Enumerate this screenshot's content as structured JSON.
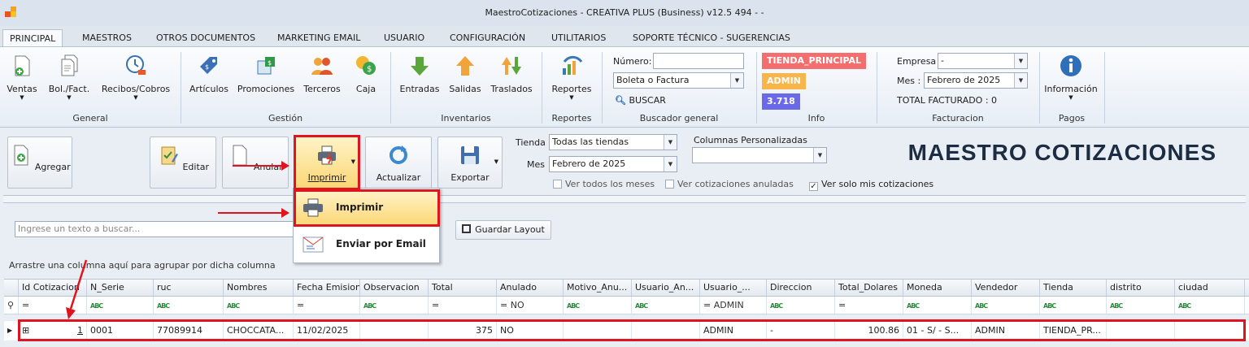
{
  "window": {
    "title": "MaestroCotizaciones - CREATIVA PLUS (Business) v12.5 494 - -"
  },
  "menu_tabs": [
    "PRINCIPAL",
    "MAESTROS",
    "OTROS DOCUMENTOS",
    "MARKETING EMAIL",
    "USUARIO",
    "CONFIGURACIÓN",
    "UTILITARIOS",
    "SOPORTE TÉCNICO - SUGERENCIAS"
  ],
  "ribbon": {
    "general": {
      "label": "General",
      "ventas": "Ventas",
      "bol_fact": "Bol./Fact.",
      "recibos": "Recibos/Cobros"
    },
    "gestion": {
      "label": "Gestión",
      "articulos": "Artículos",
      "promociones": "Promociones",
      "terceros": "Terceros",
      "caja": "Caja"
    },
    "inventarios": {
      "label": "Inventarios",
      "entradas": "Entradas",
      "salidas": "Salidas",
      "traslados": "Traslados"
    },
    "reportes": {
      "label": "Reportes",
      "reportes_btn": "Reportes"
    },
    "buscador": {
      "label": "Buscador general",
      "numero_label": "Número:",
      "numero_value": "",
      "doc_type": "Boleta o Factura",
      "buscar": "BUSCAR"
    },
    "info": {
      "label": "Info",
      "tienda": "TIENDA_PRINCIPAL",
      "usuario": "ADMIN",
      "version": "3.718"
    },
    "facturacion": {
      "label": "Facturacion",
      "empresa_label": "Empresa",
      "empresa_value": "-",
      "mes_label": "Mes :",
      "mes_value": "Febrero de 2025",
      "total": "TOTAL FACTURADO : 0"
    },
    "pagos": {
      "label": "Pagos",
      "informacion": "Información"
    }
  },
  "toolbar": {
    "agregar": "Agregar",
    "editar": "Editar",
    "anular": "Anular",
    "imprimir": "Imprimir",
    "actualizar": "Actualizar",
    "exportar": "Exportar",
    "tienda_label": "Tienda",
    "tienda_value": "Todas las tiendas",
    "mes_label": "Mes",
    "mes_value": "Febrero de 2025",
    "columnas_label": "Columnas Personalizadas",
    "columnas_value": "",
    "ver_todos": "Ver todos los meses",
    "ver_anuladas": "Ver cotizaciones anuladas",
    "ver_mias": "Ver solo mis cotizaciones",
    "page_title": "MAESTRO COTIZACIONES"
  },
  "dropdown": {
    "imprimir": "Imprimir",
    "email": "Enviar por Email"
  },
  "search": {
    "placeholder": "Ingrese un texto a buscar...",
    "guardar_layout": "Guardar Layout"
  },
  "grid": {
    "group_hint": "Arrastre una columna aquí para agrupar por dicha columna",
    "columns": [
      "Id Cotizacion",
      "N_Serie",
      "ruc",
      "Nombres",
      "Fecha Emision",
      "Observacion",
      "Total",
      "Anulado",
      "Motivo_Anu...",
      "Usuario_An...",
      "Usuario_...",
      "Direccion",
      "Total_Dolares",
      "Moneda",
      "Vendedor",
      "Tienda",
      "distrito",
      "ciudad"
    ],
    "filters": {
      "eq": "=",
      "anulado": "= NO",
      "usuario": "= ADMIN",
      "abc": "ABC"
    },
    "row": {
      "id": "1",
      "serie": "0001",
      "ruc": "77089914",
      "nombres": "CHOCCATA...",
      "fecha": "11/02/2025",
      "observacion": "",
      "total": "375",
      "anulado": "NO",
      "motivo": "",
      "usuario_an": "",
      "usuario": "ADMIN",
      "direccion": "-",
      "total_dolares": "100.86",
      "moneda": "01 - S/ - S...",
      "vendedor": "ADMIN",
      "tienda": "TIENDA_PR...",
      "distrito": "",
      "ciudad": ""
    },
    "expand": "⊞"
  },
  "colors": {
    "accent": "#e0141e",
    "badge_tienda": "#f36e6e",
    "badge_admin": "#f7b54a",
    "badge_version": "#6a69e8"
  }
}
